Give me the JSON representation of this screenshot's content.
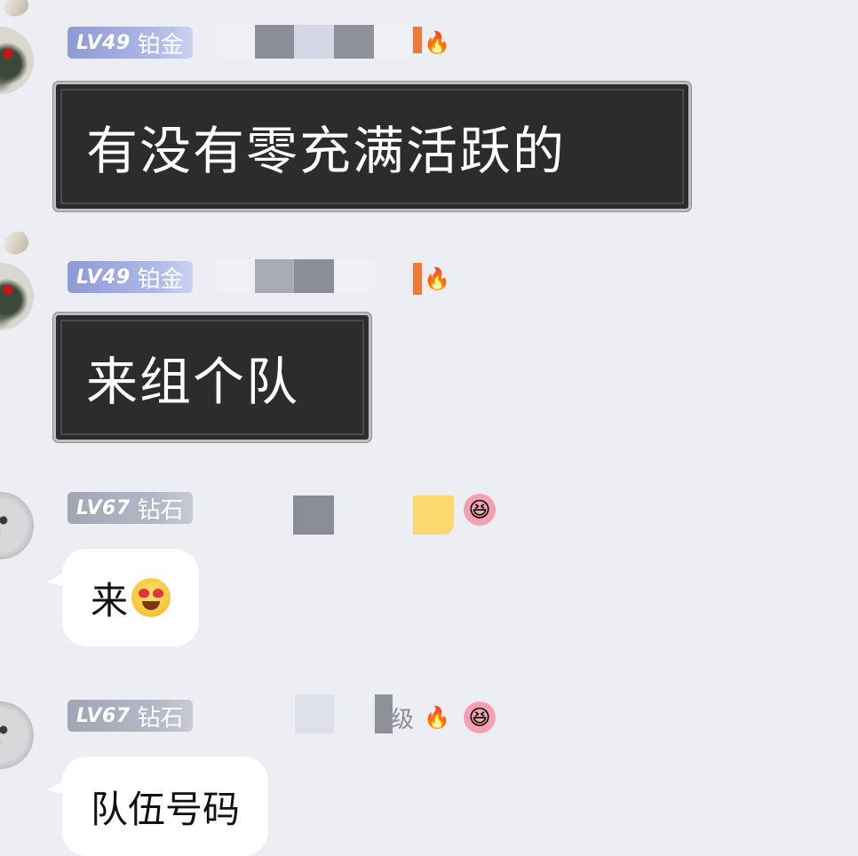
{
  "messages": [
    {
      "level": "LV49",
      "rank": "铂金",
      "text": "有没有零充满活跃的",
      "style": "dark",
      "icon": "fire-icon"
    },
    {
      "level": "LV49",
      "rank": "铂金",
      "text": "来组个队",
      "style": "dark",
      "icon": "fire-icon"
    },
    {
      "level": "LV67",
      "rank": "钻石",
      "text": "来",
      "style": "white",
      "icon": "flower-smile-icon",
      "emoji": "heart-eyes-emoji"
    },
    {
      "level": "LV67",
      "rank": "钻石",
      "tag_text": "级",
      "text": "队伍号码",
      "style": "white",
      "icons": [
        "campfire-icon",
        "flower-smile-icon"
      ]
    }
  ],
  "colors": {
    "background": "#edeef4",
    "badge_platinum": "#8e9ad6",
    "badge_diamond": "#a1a6b5",
    "dark_bubble": "#2b2c2d",
    "white_bubble": "#ffffff",
    "flame_accent": "#f07a34"
  }
}
